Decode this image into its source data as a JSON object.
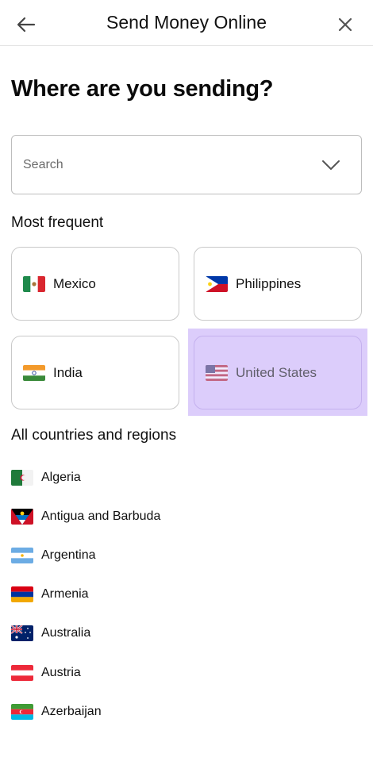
{
  "header": {
    "title": "Send Money Online",
    "back_icon": "arrow-left-icon",
    "close_icon": "close-icon"
  },
  "main": {
    "heading": "Where are you sending?",
    "search": {
      "placeholder": "Search",
      "icon": "chevron-down-icon"
    },
    "frequent_label": "Most frequent",
    "frequent": [
      {
        "label": "Mexico",
        "flag": "mexico-flag-icon"
      },
      {
        "label": "Philippines",
        "flag": "philippines-flag-icon"
      },
      {
        "label": "India",
        "flag": "india-flag-icon"
      },
      {
        "label": "United States",
        "flag": "usa-flag-icon",
        "state": "selected"
      }
    ],
    "all_label": "All countries and regions",
    "countries": [
      {
        "label": "Algeria",
        "flag": "algeria-flag-icon"
      },
      {
        "label": "Antigua and Barbuda",
        "flag": "antigua-flag-icon"
      },
      {
        "label": "Argentina",
        "flag": "argentina-flag-icon"
      },
      {
        "label": "Armenia",
        "flag": "armenia-flag-icon"
      },
      {
        "label": "Australia",
        "flag": "australia-flag-icon"
      },
      {
        "label": "Austria",
        "flag": "austria-flag-icon"
      },
      {
        "label": "Azerbaijan",
        "flag": "azerbaijan-flag-icon"
      }
    ]
  },
  "colors": {
    "selection_highlight": "#dccdfb",
    "border": "#c9c9c9",
    "text": "#111111"
  }
}
